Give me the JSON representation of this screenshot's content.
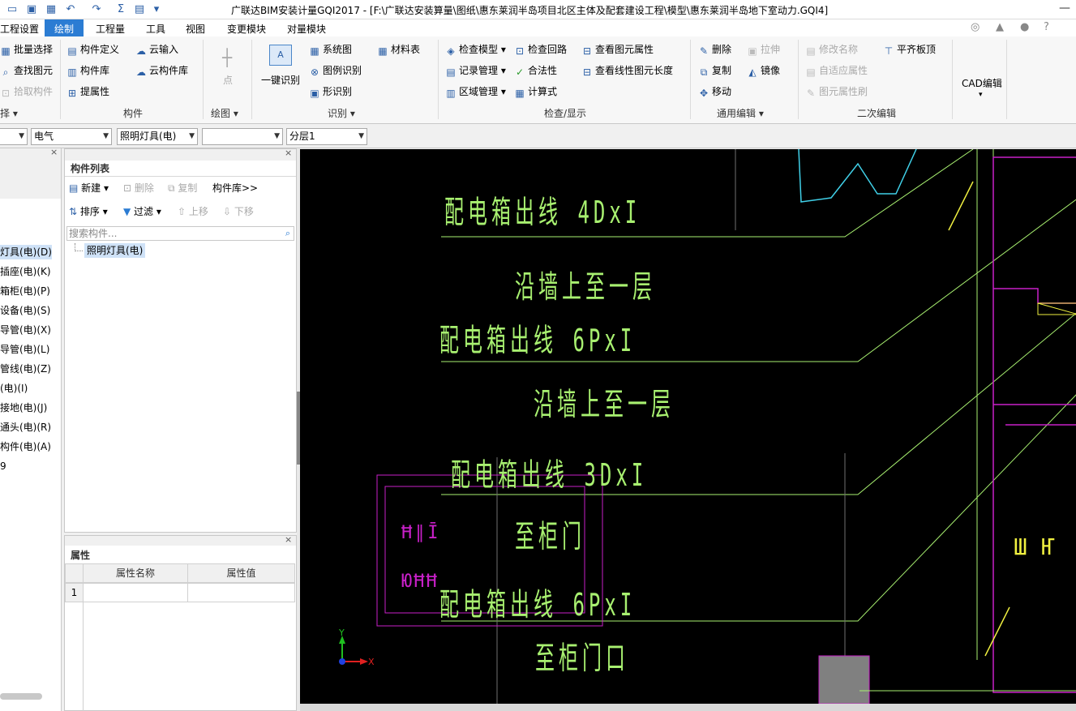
{
  "app": {
    "title": "广联达BIM安装计量GQI2017 - [F:\\广联达安装算量\\图纸\\惠东莱润半岛项目北区主体及配套建设工程\\模型\\惠东莱润半岛地下室动力.GQI4]"
  },
  "menu": {
    "items": [
      "工程设置",
      "绘制",
      "工程量",
      "工具",
      "视图",
      "变更模块",
      "对量模块"
    ],
    "active": "绘制",
    "right_icons": [
      "user-icon",
      "bell-icon",
      "chat-icon",
      "help-icon"
    ],
    "help_label": "?"
  },
  "ribbon": {
    "select_group": {
      "batch_select": "批量选择",
      "find_element": "查找图元",
      "pick_component": "拾取构件",
      "label": "选择"
    },
    "component_group": {
      "define": "构件定义",
      "library": "构件库",
      "extract_attr": "提属性",
      "cloud_input": "云输入",
      "cloud_library": "云构件库",
      "label": "构件"
    },
    "draw_group": {
      "point": "点",
      "label": "绘图"
    },
    "recognize_group": {
      "one_click": "一键识别",
      "system_chart": "系统图",
      "legend": "图例识别",
      "shape": "形识别",
      "material_table": "材料表",
      "label": "识别"
    },
    "check_group": {
      "check_model": "检查模型",
      "record_mgmt": "记录管理",
      "area_mgmt": "区域管理",
      "check_loop": "检查回路",
      "legality": "合法性",
      "calc_formula": "计算式",
      "view_attr": "查看图元属性",
      "view_length": "查看线性图元长度",
      "label": "检查/显示"
    },
    "edit_group": {
      "delete": "删除",
      "copy": "复制",
      "move": "移动",
      "stretch": "拉伸",
      "mirror": "镜像",
      "label": "通用编辑"
    },
    "secondary_group": {
      "rename": "修改名称",
      "adaptive": "自适应属性",
      "brush": "图元属性刷",
      "align": "平齐板顶",
      "label": "二次编辑"
    },
    "cad_group": {
      "label": "CAD编辑"
    }
  },
  "filters": {
    "discipline": "电气",
    "type": "照明灯具(电)",
    "component": "",
    "layer": "分层1"
  },
  "nav": {
    "items": [
      {
        "label": "灯具(电)(D)",
        "selected": true
      },
      {
        "label": "插座(电)(K)",
        "selected": false
      },
      {
        "label": "箱柜(电)(P)",
        "selected": false
      },
      {
        "label": "设备(电)(S)",
        "selected": false
      },
      {
        "label": "导管(电)(X)",
        "selected": false
      },
      {
        "label": "导管(电)(L)",
        "selected": false
      },
      {
        "label": "管线(电)(Z)",
        "selected": false
      },
      {
        "label": "(电)(I)",
        "selected": false
      },
      {
        "label": "接地(电)(J)",
        "selected": false
      },
      {
        "label": "通头(电)(R)",
        "selected": false
      },
      {
        "label": "构件(电)(A)",
        "selected": false
      },
      {
        "label": "9",
        "selected": false
      }
    ]
  },
  "component_list": {
    "title": "构件列表",
    "new": "新建",
    "delete": "删除",
    "copy": "复制",
    "library": "构件库>>",
    "sort": "排序",
    "filter": "过滤",
    "move_up": "上移",
    "move_down": "下移",
    "search_placeholder": "搜索构件...",
    "tree_item": "照明灯具(电)"
  },
  "properties": {
    "title": "属性",
    "col_name": "属性名称",
    "col_value": "属性值",
    "row1_index": "1"
  },
  "cad": {
    "texts": [
      "配电箱出线 4DxI",
      "沿墙上至一层",
      "配电箱出线 6PxI",
      "沿墙上至一层",
      "配电箱出线 3DxI",
      "至柜门",
      "配电箱出线 6PxI",
      "至柜门口"
    ],
    "axis_x": "X",
    "axis_y": "Y",
    "colors": {
      "line": "#a8f070",
      "magenta": "#c820c8",
      "cyan": "#40d0e8",
      "yellow": "#f0f040",
      "gray_block": "#808080"
    }
  }
}
